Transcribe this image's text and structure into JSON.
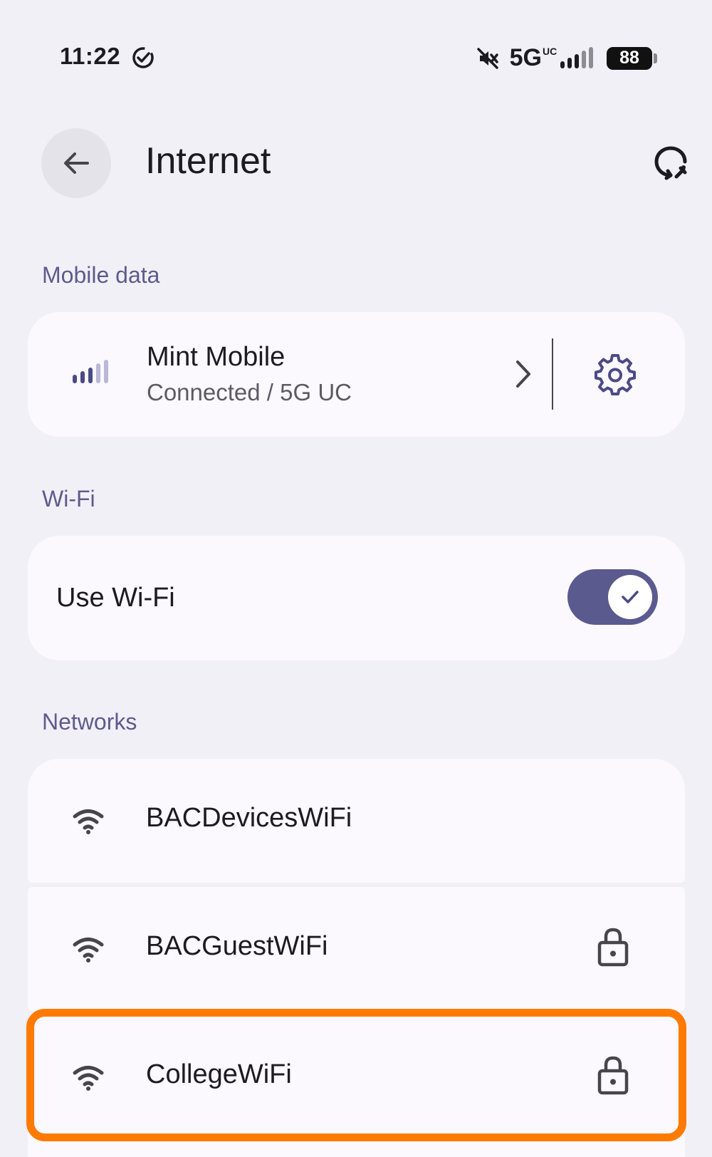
{
  "status_bar": {
    "time": "11:22",
    "network_type": "5G",
    "network_sup": "UC",
    "battery": "88"
  },
  "header": {
    "title": "Internet"
  },
  "sections": {
    "mobile_data": "Mobile data",
    "wifi": "Wi-Fi",
    "networks": "Networks"
  },
  "mobile": {
    "carrier": "Mint Mobile",
    "status": "Connected / 5G UC"
  },
  "wifi": {
    "label": "Use Wi-Fi",
    "enabled": true
  },
  "networks": [
    {
      "name": "BACDevicesWiFi",
      "locked": false
    },
    {
      "name": "BACGuestWiFi",
      "locked": true
    },
    {
      "name": "CollegeWiFi",
      "locked": true
    }
  ],
  "colors": {
    "background": "#F1F0F7",
    "card": "#FBF8FE",
    "accent": "#5B5A8F",
    "section_header": "#5E5A8E",
    "highlight": "#FF7A00"
  }
}
